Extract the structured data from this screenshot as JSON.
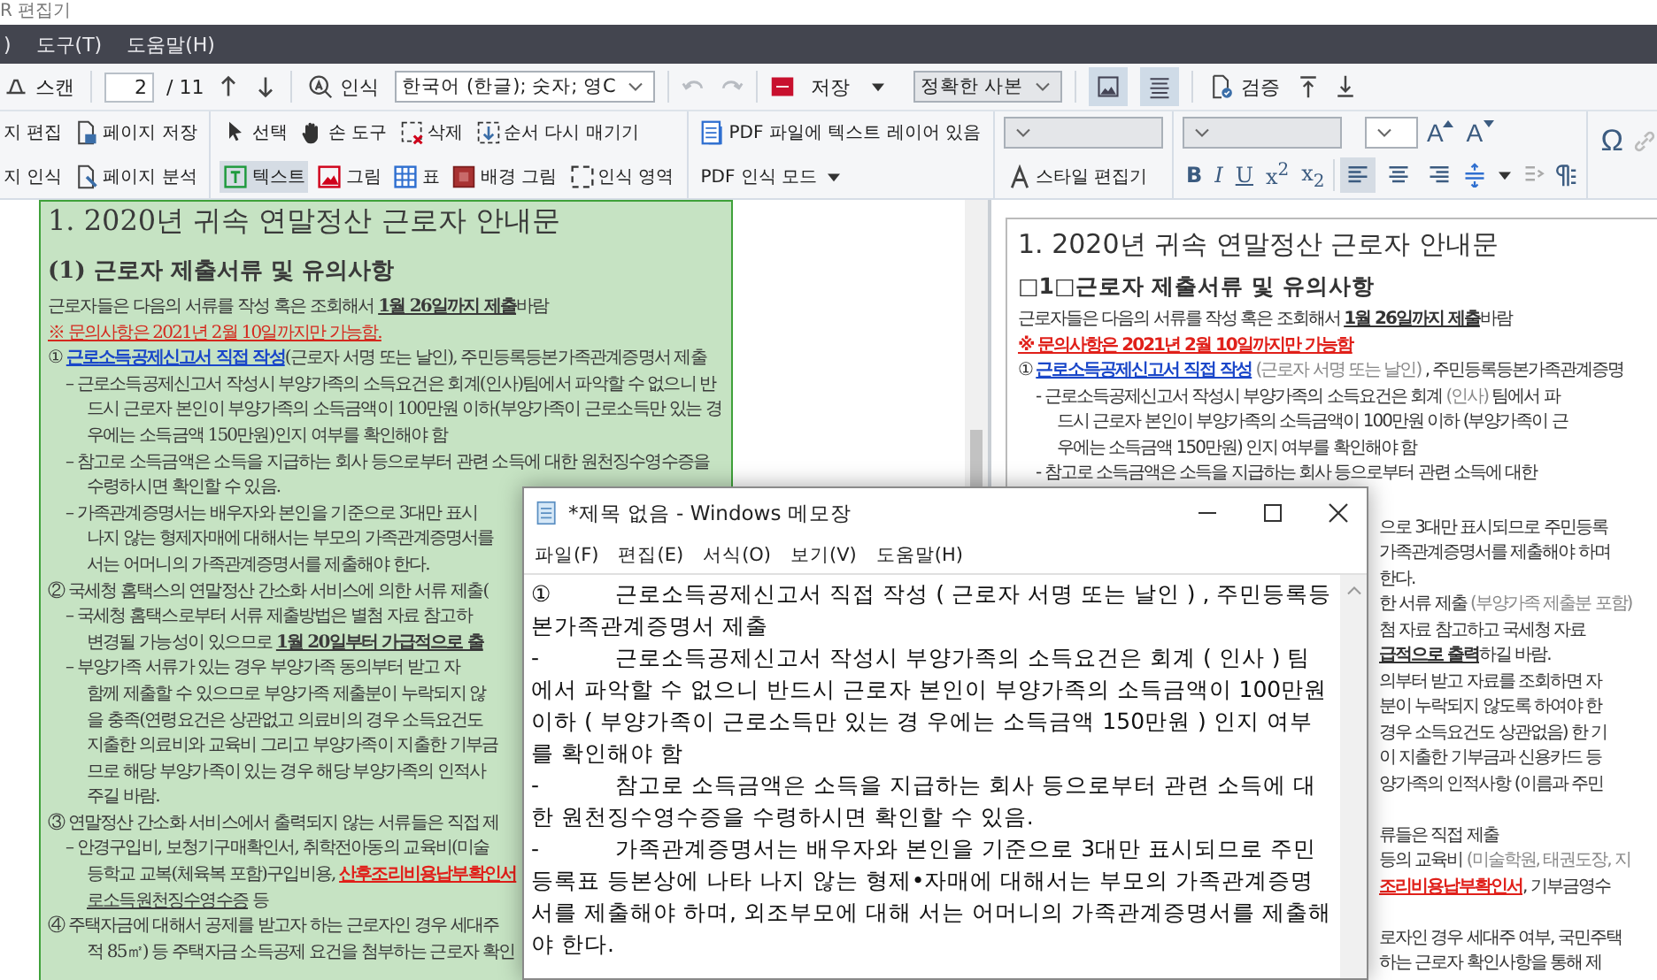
{
  "window": {
    "title": "R 편집기"
  },
  "menu": [
    ")",
    "도구(T)",
    "도움말(H)"
  ],
  "toolbar": {
    "scan": "스캔",
    "page": "2",
    "page_total": "/ 11",
    "recognize": "인식",
    "language": "한국어 (한글); 숫자; 영C",
    "history": [
      {
        "disabled": true
      },
      {
        "disabled": true
      }
    ],
    "save": "저장",
    "save_mode": "정확한 사본",
    "views": [
      {
        "selected": true
      },
      {
        "selected": true
      }
    ],
    "verify": "검증"
  },
  "ribbon": {
    "page_tools": [
      "지 편집",
      "페이지 저장",
      "지 인식",
      "페이지 분석"
    ],
    "area_tools": [
      {
        "label": "선택",
        "selected": false
      },
      {
        "label": "손 도구",
        "selected": false
      },
      {
        "label": "삭제",
        "selected": false
      },
      {
        "label": "순서 다시 매기기",
        "selected": false
      },
      {
        "label": "텍스트",
        "selected": true
      },
      {
        "label": "그림",
        "selected": false
      },
      {
        "label": "표",
        "selected": false
      },
      {
        "label": "배경 그림",
        "selected": false
      },
      {
        "label": "인식 영역",
        "selected": false
      }
    ],
    "pdf_text_layer": "PDF 파일에 텍스트 레이어 있음",
    "pdf_mode": "PDF 인식 모드",
    "style_editor": "스타일 편집기",
    "font_size_buttons": [
      "A",
      "A"
    ],
    "format_buttons": [
      "B",
      "I",
      "U",
      "x$^{2}$",
      "x$_{2}$"
    ],
    "align": [
      {
        "selected": true
      },
      {
        "selected": false
      },
      {
        "selected": false
      }
    ],
    "special_char": "Ω"
  },
  "image_doc": {
    "title": "1. 2020년 귀속 연말정산 근로자 안내문",
    "subtitle": "(1) 근로자 제출서류 및 유의사항",
    "lines": [
      {
        "kind": "plain",
        "parts": [
          {
            "text": "근로자들은 다음의 서류를 작성 혹은 조회해서 "
          },
          {
            "text": "1월 26일까지 제출",
            "kind": "emphasis"
          },
          {
            "text": "바람"
          }
        ]
      },
      {
        "kind": "plain",
        "parts": [
          {
            "text": "※ 문의사항은 2021년 2월 10일까지만 가능함.",
            "kind": "warning"
          }
        ]
      },
      {
        "kind": "item",
        "parts": [
          {
            "text": "① "
          },
          {
            "text": "근로소득공제신고서 직접 작성",
            "kind": "heading-link"
          },
          {
            "text": "(근로자 서명 또는 날인), 주민등록등본가족관계증명서 제출"
          }
        ]
      },
      {
        "kind": "dash",
        "parts": [
          {
            "text": "– 근로소득공제신고서 작성시 부양가족의 소득요건은 회계(인사)팀에서 파악할 수 없으니 반"
          }
        ]
      },
      {
        "kind": "cont",
        "parts": [
          {
            "text": "드시 근로자 본인이 부양가족의 소득금액이 100만원 이하(부양가족이 근로소득만 있는 경"
          }
        ]
      },
      {
        "kind": "cont",
        "parts": [
          {
            "text": "우에는 소득금액 150만원)인지 여부를 확인해야 함"
          }
        ]
      },
      {
        "kind": "dash",
        "parts": [
          {
            "text": "– 참고로 소득금액은 소득을 지급하는 회사 등으로부터 관련 소득에 대한 원천징수영수증을"
          }
        ]
      },
      {
        "kind": "cont",
        "parts": [
          {
            "text": "수령하시면 확인할 수 있음."
          }
        ]
      },
      {
        "kind": "dash",
        "parts": [
          {
            "text": "– 가족관계증명서는 배우자와 본인을 기준으로 3대만 표시"
          }
        ]
      },
      {
        "kind": "cont",
        "parts": [
          {
            "text": "나지 않는 형제자매에 대해서는 부모의 가족관계증명서를"
          }
        ]
      },
      {
        "kind": "cont",
        "parts": [
          {
            "text": "서는 어머니의 가족관계증명서를 제출해야 한다."
          }
        ]
      },
      {
        "kind": "item",
        "parts": [
          {
            "text": "② 국세청 홈택스의 연말정산 간소화 서비스에 의한 서류 제출("
          }
        ]
      },
      {
        "kind": "dash",
        "parts": [
          {
            "text": "– 국세청 홈택스로부터 서류 제출방법은 별첨 자료 참고하"
          }
        ]
      },
      {
        "kind": "cont",
        "parts": [
          {
            "text": "변경될 가능성이 있으므로 "
          },
          {
            "text": "1월 20일부터 가급적으로 출",
            "kind": "emphasis"
          }
        ]
      },
      {
        "kind": "dash",
        "parts": [
          {
            "text": "– 부양가족 서류가 있는 경우 부양가족 동의부터 받고 자"
          }
        ]
      },
      {
        "kind": "cont",
        "parts": [
          {
            "text": "함께 제출할 수 있으므로 부양가족 제출분이 누락되지 않"
          }
        ]
      },
      {
        "kind": "cont",
        "parts": [
          {
            "text": "을 충족(연령요건은 상관없고 의료비의 경우 소득요건도"
          }
        ]
      },
      {
        "kind": "cont",
        "parts": [
          {
            "text": "지출한 의료비와 교육비 그리고 부양가족이 지출한 기부금"
          }
        ]
      },
      {
        "kind": "cont",
        "parts": [
          {
            "text": "므로 해당 부양가족이 있는 경우 해당 부양가족의 인적사"
          }
        ]
      },
      {
        "kind": "cont",
        "parts": [
          {
            "text": "주길 바람."
          }
        ]
      },
      {
        "kind": "item",
        "parts": [
          {
            "text": "③ 연말정산 간소화 서비스에서 출력되지 않는 서류들은 직접 제"
          }
        ]
      },
      {
        "kind": "dash",
        "parts": [
          {
            "text": "– 안경구입비, 보청기구매확인서, 취학전아동의 교육비(미술"
          }
        ]
      },
      {
        "kind": "cont",
        "parts": [
          {
            "text": "등학교 교복(체육복 포함)구입비용, "
          },
          {
            "text": "산후조리비용납부확인서",
            "kind": "warning-emphasis"
          }
        ]
      },
      {
        "kind": "cont",
        "parts": [
          {
            "text": "로소득원천징수영수증",
            "kind": "underlined"
          },
          {
            "text": " 등"
          }
        ]
      },
      {
        "kind": "item",
        "parts": [
          {
            "text": "④ 주택자금에 대해서 공제를 받고자 하는 근로자인 경우 세대주"
          }
        ]
      },
      {
        "kind": "cont",
        "parts": [
          {
            "text": "적 85㎡) 등 주택자금 소득공제 요건을 첨부하는 근로자 확인"
          }
        ]
      }
    ]
  },
  "text_doc": {
    "title": "1. 2020년 귀속 연말정산 근로자 안내문",
    "subtitle": "□1□근로자 제출서류 및 유의사항",
    "lines": [
      {
        "kind": "plain",
        "parts": [
          {
            "text": "근로자들은 다음의 서류를 작성 혹은 조회해서 "
          },
          {
            "text": "1월 26일까지 제출",
            "kind": "emphasis"
          },
          {
            "text": "바람"
          }
        ]
      },
      {
        "kind": "plain",
        "parts": [
          {
            "text": "※ 문의사항은 2021년 2월 10일까지만 가능함",
            "kind": "warning-emphasis"
          }
        ]
      },
      {
        "kind": "item",
        "parts": [
          {
            "text": "① "
          },
          {
            "text": "근로소득공제신고서 직접 작성",
            "kind": "heading-link"
          },
          {
            "text": " (근로자 서명 또는 날인)",
            "kind": "aside"
          },
          {
            "text": " , 주민등록등본가족관계증명"
          }
        ]
      },
      {
        "kind": "dash",
        "parts": [
          {
            "text": "- 근로소득공제신고서 작성시 부양가족의 소득요건은 회계 "
          },
          {
            "text": "(인사)",
            "kind": "aside"
          },
          {
            "text": " 팀에서 파"
          }
        ]
      },
      {
        "kind": "cont",
        "parts": [
          {
            "text": "드시 근로자 본인이 부양가족의 소득금액이 100만원 이하 (부양가족이 근"
          }
        ]
      },
      {
        "kind": "cont",
        "parts": [
          {
            "text": "우에는 소득금액 150만원) 인지 여부를 확인해야 함"
          }
        ]
      },
      {
        "kind": "dash",
        "parts": [
          {
            "text": "- 참고로 소득금액은 소득을 지급하는 회사 등으로부터 관련 소득에 대한"
          }
        ]
      }
    ],
    "fragments": [
      {
        "kind": "line",
        "parts": [
          {
            "text": "으로 3대만 표시되므로 주민등록"
          }
        ]
      },
      {
        "kind": "line",
        "parts": [
          {
            "text": "가족관계증명서를 제출해야 하며"
          }
        ]
      },
      {
        "kind": "line",
        "parts": [
          {
            "text": "한다."
          }
        ]
      },
      {
        "kind": "line",
        "parts": [
          {
            "text": "한 서류 제출 "
          },
          {
            "text": "(부양가족 제출분 포함)",
            "kind": "aside"
          }
        ]
      },
      {
        "kind": "line",
        "parts": [
          {
            "text": "첨 자료 참고하고 국세청 자료"
          }
        ]
      },
      {
        "kind": "line",
        "parts": [
          {
            "text": "급적으로 출력",
            "kind": "emphasis"
          },
          {
            "text": "하길 바람."
          }
        ]
      },
      {
        "kind": "line",
        "parts": [
          {
            "text": "의부터 받고 자료를 조회하면 자"
          }
        ]
      },
      {
        "kind": "line",
        "parts": [
          {
            "text": "분이 누락되지 않도록 하여야 한"
          }
        ]
      },
      {
        "kind": "line",
        "parts": [
          {
            "text": "경우 소득요건도 상관없음) 한 기"
          }
        ]
      },
      {
        "kind": "line",
        "parts": [
          {
            "text": "이 지출한 기부금과 신용카드 등"
          }
        ]
      },
      {
        "kind": "line",
        "parts": [
          {
            "text": "양가족의 인적사항 (이름과 주민"
          }
        ]
      },
      {
        "kind": "para",
        "parts": [
          {
            "text": "류들은 직접 제출"
          }
        ]
      },
      {
        "kind": "line",
        "parts": [
          {
            "text": "등의 교육비 "
          },
          {
            "text": "(미술학원, 태권도장, 지",
            "kind": "aside"
          }
        ]
      },
      {
        "kind": "line",
        "parts": [
          {
            "text": "조리비용납부확인서",
            "kind": "warning-emphasis"
          },
          {
            "text": ", 기부금영수"
          }
        ]
      },
      {
        "kind": "para",
        "parts": [
          {
            "text": "로자인 경우 세대주 여부, 국민주택"
          }
        ]
      },
      {
        "kind": "line",
        "parts": [
          {
            "text": "하는 근로자 확인사항을 통해 제"
          }
        ]
      }
    ]
  },
  "notepad": {
    "title": "*제목 없음 - Windows 메모장",
    "menu": [
      "파일(F)",
      "편집(E)",
      "서식(O)",
      "보기(V)",
      "도움말(H)"
    ],
    "lines": [
      "①\t근로소득공제신고서 직접 작성 ( 근로자 서명 또는 날인 ) , 주민등록등본가족관계증명서 제출",
      "-\t근로소득공제신고서 작성시 부양가족의 소득요건은 회계 ( 인사 ) 팀에서 파악할 수 없으니 반드시 근로자 본인이 부양가족의 소득금액이 100만원 이하 ( 부양가족이 근로소득만 있는 경 우에는 소득금액 150만원 ) 인지 여부를 확인해야 함",
      "-\t참고로 소득금액은 소득을 지급하는 회사 등으로부터 관련 소득에 대한 원천징수영수증을 수령하시면 확인할 수 있음.",
      "-\t가족관계증명서는 배우자와 본인을 기준으로 3대만 표시되므로 주민등록표 등본상에 나타 나지 않는 형제•자매에 대해서는 부모의 가족관계증명서를 제출해야 하며, 외조부모에 대해 서는 어머니의 가족관계증명서를 제출해야 한다."
    ]
  }
}
